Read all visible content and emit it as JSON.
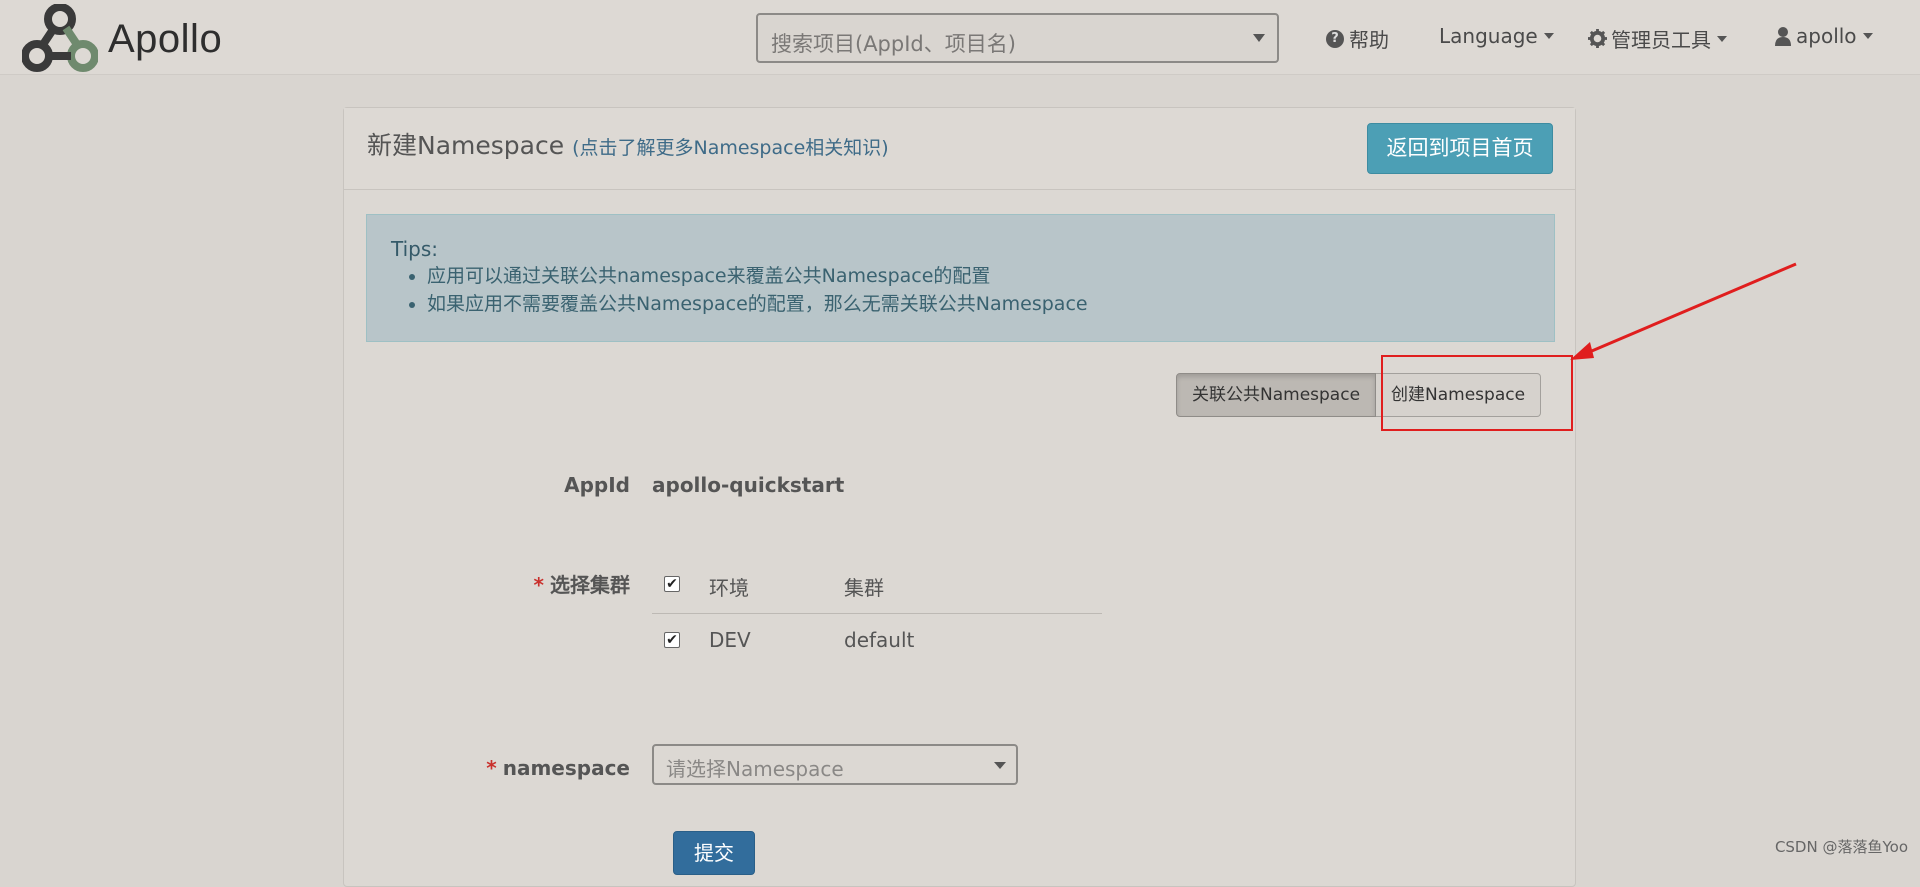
{
  "brand": {
    "name": "Apollo",
    "logo_icon": "apollo-logo-icon"
  },
  "nav": {
    "search_placeholder": "搜索项目(AppId、项目名)",
    "help": "帮助",
    "language": "Language",
    "admin_tools": "管理员工具",
    "user": "apollo"
  },
  "panel": {
    "title": "新建Namespace",
    "title_link": "(点击了解更多Namespace相关知识)",
    "back_button": "返回到项目首页"
  },
  "tips": {
    "title": "Tips:",
    "items": [
      "应用可以通过关联公共namespace来覆盖公共Namespace的配置",
      "如果应用不需要覆盖公共Namespace的配置，那么无需关联公共Namespace"
    ]
  },
  "mode_buttons": {
    "link_public": "关联公共Namespace",
    "create": "创建Namespace"
  },
  "form": {
    "appid_label": "AppId",
    "appid_value": "apollo-quickstart",
    "cluster_label": "选择集群",
    "cluster_table": {
      "headers": [
        "环境",
        "集群"
      ],
      "rows": [
        {
          "env": "DEV",
          "cluster": "default",
          "checked": true
        }
      ],
      "header_checked": true
    },
    "namespace_label": "namespace",
    "namespace_placeholder": "请选择Namespace",
    "submit": "提交",
    "required_mark": "*"
  },
  "watermark": "CSDN @落落鱼Yoo",
  "colors": {
    "accent": "#4c9fb5",
    "primary": "#326d9c",
    "highlight": "#e01e1e"
  }
}
